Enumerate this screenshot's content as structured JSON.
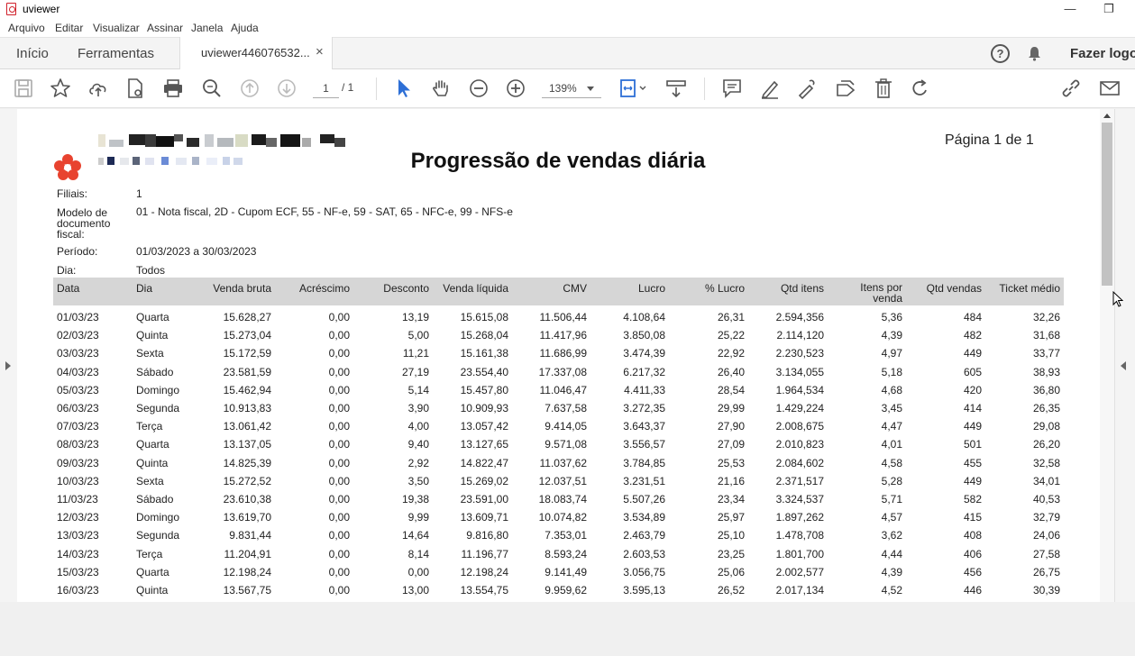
{
  "window": {
    "title": "uviewer",
    "minimize_glyph": "—",
    "restore_glyph": "❐"
  },
  "menu": [
    "Arquivo",
    "Editar",
    "Visualizar",
    "Assinar",
    "Janela",
    "Ajuda"
  ],
  "nav": {
    "home": "Início",
    "tools": "Ferramentas",
    "tab_label": "uviewer446076532...",
    "tab_close": "×",
    "login": "Fazer logon",
    "help_glyph": "?"
  },
  "toolbar": {
    "page_current": "1",
    "page_total": "/ 1",
    "zoom": "139%",
    "icons": [
      "save-icon",
      "star-icon",
      "upload-cloud-icon",
      "file-settings-icon",
      "print-icon",
      "zoom-search-icon",
      "page-up-icon",
      "page-down-icon",
      "select-pointer-icon",
      "hand-icon",
      "zoom-out-icon",
      "zoom-in-icon",
      "fit-page-icon",
      "read-mode-icon",
      "comment-icon",
      "highlight-icon",
      "sign-icon",
      "stamp-icon",
      "delete-icon",
      "rotate-icon",
      "link-icon",
      "email-icon"
    ]
  },
  "report": {
    "page_number": "Página 1 de 1",
    "title": "Progressão de vendas diária",
    "filters": [
      {
        "label": "Filiais:",
        "value": "1"
      },
      {
        "label": "Modelo de documento fiscal:",
        "value": "01 - Nota fiscal, 2D - Cupom ECF, 55 - NF-e, 59 - SAT, 65 - NFC-e, 99 - NFS-e"
      },
      {
        "label": "Período:",
        "value": "01/03/2023 a 30/03/2023"
      },
      {
        "label": "Dia:",
        "value": "Todos"
      }
    ],
    "columns": [
      "Data",
      "Dia",
      "Venda bruta",
      "Acréscimo",
      "Desconto",
      "Venda líquida",
      "CMV",
      "Lucro",
      "% Lucro",
      "Qtd itens",
      "Itens por venda",
      "Qtd vendas",
      "Ticket médio"
    ],
    "rows": [
      [
        "01/03/23",
        "Quarta",
        "15.628,27",
        "0,00",
        "13,19",
        "15.615,08",
        "11.506,44",
        "4.108,64",
        "26,31",
        "2.594,356",
        "5,36",
        "484",
        "32,26"
      ],
      [
        "02/03/23",
        "Quinta",
        "15.273,04",
        "0,00",
        "5,00",
        "15.268,04",
        "11.417,96",
        "3.850,08",
        "25,22",
        "2.114,120",
        "4,39",
        "482",
        "31,68"
      ],
      [
        "03/03/23",
        "Sexta",
        "15.172,59",
        "0,00",
        "11,21",
        "15.161,38",
        "11.686,99",
        "3.474,39",
        "22,92",
        "2.230,523",
        "4,97",
        "449",
        "33,77"
      ],
      [
        "04/03/23",
        "Sábado",
        "23.581,59",
        "0,00",
        "27,19",
        "23.554,40",
        "17.337,08",
        "6.217,32",
        "26,40",
        "3.134,055",
        "5,18",
        "605",
        "38,93"
      ],
      [
        "05/03/23",
        "Domingo",
        "15.462,94",
        "0,00",
        "5,14",
        "15.457,80",
        "11.046,47",
        "4.411,33",
        "28,54",
        "1.964,534",
        "4,68",
        "420",
        "36,80"
      ],
      [
        "06/03/23",
        "Segunda",
        "10.913,83",
        "0,00",
        "3,90",
        "10.909,93",
        "7.637,58",
        "3.272,35",
        "29,99",
        "1.429,224",
        "3,45",
        "414",
        "26,35"
      ],
      [
        "07/03/23",
        "Terça",
        "13.061,42",
        "0,00",
        "4,00",
        "13.057,42",
        "9.414,05",
        "3.643,37",
        "27,90",
        "2.008,675",
        "4,47",
        "449",
        "29,08"
      ],
      [
        "08/03/23",
        "Quarta",
        "13.137,05",
        "0,00",
        "9,40",
        "13.127,65",
        "9.571,08",
        "3.556,57",
        "27,09",
        "2.010,823",
        "4,01",
        "501",
        "26,20"
      ],
      [
        "09/03/23",
        "Quinta",
        "14.825,39",
        "0,00",
        "2,92",
        "14.822,47",
        "11.037,62",
        "3.784,85",
        "25,53",
        "2.084,602",
        "4,58",
        "455",
        "32,58"
      ],
      [
        "10/03/23",
        "Sexta",
        "15.272,52",
        "0,00",
        "3,50",
        "15.269,02",
        "12.037,51",
        "3.231,51",
        "21,16",
        "2.371,517",
        "5,28",
        "449",
        "34,01"
      ],
      [
        "11/03/23",
        "Sábado",
        "23.610,38",
        "0,00",
        "19,38",
        "23.591,00",
        "18.083,74",
        "5.507,26",
        "23,34",
        "3.324,537",
        "5,71",
        "582",
        "40,53"
      ],
      [
        "12/03/23",
        "Domingo",
        "13.619,70",
        "0,00",
        "9,99",
        "13.609,71",
        "10.074,82",
        "3.534,89",
        "25,97",
        "1.897,262",
        "4,57",
        "415",
        "32,79"
      ],
      [
        "13/03/23",
        "Segunda",
        "9.831,44",
        "0,00",
        "14,64",
        "9.816,80",
        "7.353,01",
        "2.463,79",
        "25,10",
        "1.478,708",
        "3,62",
        "408",
        "24,06"
      ],
      [
        "14/03/23",
        "Terça",
        "11.204,91",
        "0,00",
        "8,14",
        "11.196,77",
        "8.593,24",
        "2.603,53",
        "23,25",
        "1.801,700",
        "4,44",
        "406",
        "27,58"
      ],
      [
        "15/03/23",
        "Quarta",
        "12.198,24",
        "0,00",
        "0,00",
        "12.198,24",
        "9.141,49",
        "3.056,75",
        "25,06",
        "2.002,577",
        "4,39",
        "456",
        "26,75"
      ],
      [
        "16/03/23",
        "Quinta",
        "13.567,75",
        "0,00",
        "13,00",
        "13.554,75",
        "9.959,62",
        "3.595,13",
        "26,52",
        "2.017,134",
        "4,52",
        "446",
        "30,39"
      ]
    ]
  },
  "colors": {
    "header_band": "#d6d6d6",
    "logo_red": "#e8432f",
    "accent_blue": "#2d6fd6"
  }
}
